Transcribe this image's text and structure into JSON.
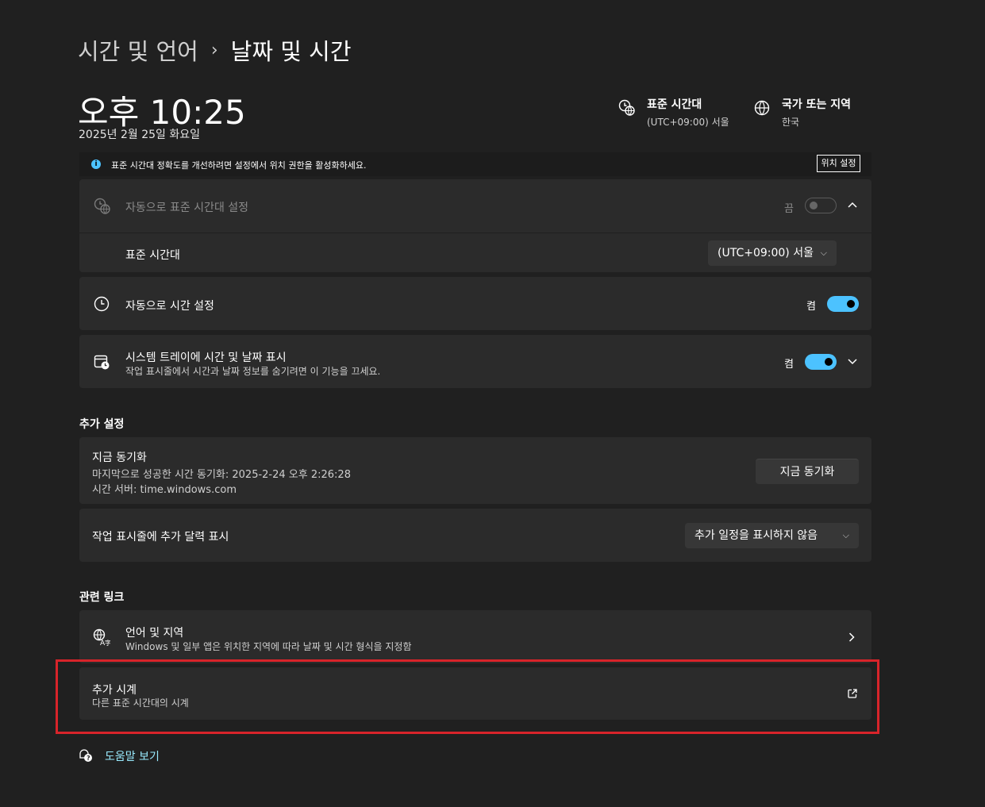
{
  "breadcrumb": {
    "parent": "시간 및 언어",
    "separator": "›",
    "current": "날짜 및 시간"
  },
  "clock": {
    "time": "오후 10:25",
    "date": "2025년 2월 25일 화요일"
  },
  "header_info": {
    "timezone": {
      "title": "표준 시간대",
      "value": "(UTC+09:00) 서울",
      "icon": "timezone-globe-icon"
    },
    "region": {
      "title": "국가 또는 지역",
      "value": "한국",
      "icon": "globe-icon"
    }
  },
  "banner": {
    "text": "표준 시간대 정확도를 개선하려면 설정에서 위치 권한을 활성화하세요.",
    "button": "위치 설정",
    "icon": "info-icon"
  },
  "auto_timezone": {
    "label": "자동으로 표준 시간대 설정",
    "toggle_label": "끔",
    "toggle_state": "off",
    "icon": "timezone-globe-icon",
    "expand_icon": "chevron-up-icon"
  },
  "timezone_row": {
    "label": "표준 시간대",
    "selected": "(UTC+09:00) 서울"
  },
  "auto_time": {
    "label": "자동으로 시간 설정",
    "toggle_label": "켬",
    "toggle_state": "on",
    "icon": "clock-icon"
  },
  "tray": {
    "label": "시스템 트레이에 시간 및 날짜 표시",
    "sub": "작업 표시줄에서 시간과 날짜 정보를 숨기려면 이 기능을 끄세요.",
    "toggle_label": "켬",
    "toggle_state": "on",
    "icon": "calendar-clock-icon",
    "expand_icon": "chevron-down-icon"
  },
  "additional": {
    "heading": "추가 설정",
    "sync": {
      "title": "지금 동기화",
      "last_sync": "마지막으로 성공한 시간 동기화: 2025-2-24 오후 2:26:28",
      "server": "시간 서버: time.windows.com",
      "button": "지금 동기화"
    },
    "calendar": {
      "label": "작업 표시줄에 추가 달력 표시",
      "selected": "추가 일정을 표시하지 않음"
    }
  },
  "related": {
    "heading": "관련 링크",
    "language": {
      "title": "언어 및 지역",
      "sub": "Windows 및 일부 앱은 위치한 지역에 따라 날짜 및 시간 형식을 지정함",
      "icon": "language-region-icon"
    },
    "clocks": {
      "title": "추가 시계",
      "sub": "다른 표준 시간대의 시계",
      "icon": "external-link-icon"
    }
  },
  "help": {
    "label": "도움말 보기",
    "icon": "help-icon"
  },
  "colors": {
    "accent": "#4cc2ff",
    "highlight": "#d8242a",
    "background": "#202020",
    "card": "#2b2b2b"
  }
}
